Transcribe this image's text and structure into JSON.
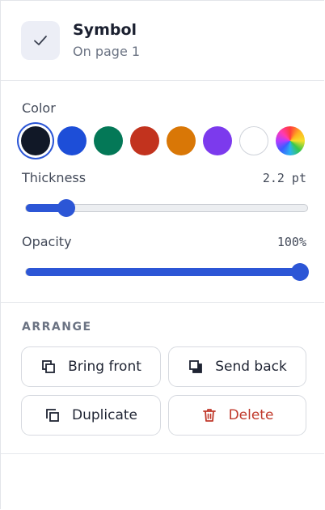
{
  "symbol": {
    "title": "Symbol",
    "subtitle": "On page 1"
  },
  "style": {
    "color_label": "Color",
    "swatches": [
      {
        "name": "black",
        "hex": "#111827",
        "selected": true
      },
      {
        "name": "blue",
        "hex": "#1d4ed8"
      },
      {
        "name": "green",
        "hex": "#047857"
      },
      {
        "name": "red",
        "hex": "#c2331e"
      },
      {
        "name": "orange",
        "hex": "#d97706"
      },
      {
        "name": "purple",
        "hex": "#7c3aed"
      },
      {
        "name": "white",
        "hex": "#ffffff"
      },
      {
        "name": "custom-rainbow",
        "hex": "rainbow"
      }
    ],
    "thickness_label": "Thickness",
    "thickness_value": "2.2 pt",
    "thickness_fraction": 0.12,
    "opacity_label": "Opacity",
    "opacity_value": "100%",
    "opacity_fraction": 1.0,
    "accent": "#2c56d6"
  },
  "arrange": {
    "title": "ARRANGE",
    "bring_front": "Bring front",
    "send_back": "Send back",
    "duplicate": "Duplicate",
    "delete": "Delete",
    "danger_color": "#c0392b"
  }
}
